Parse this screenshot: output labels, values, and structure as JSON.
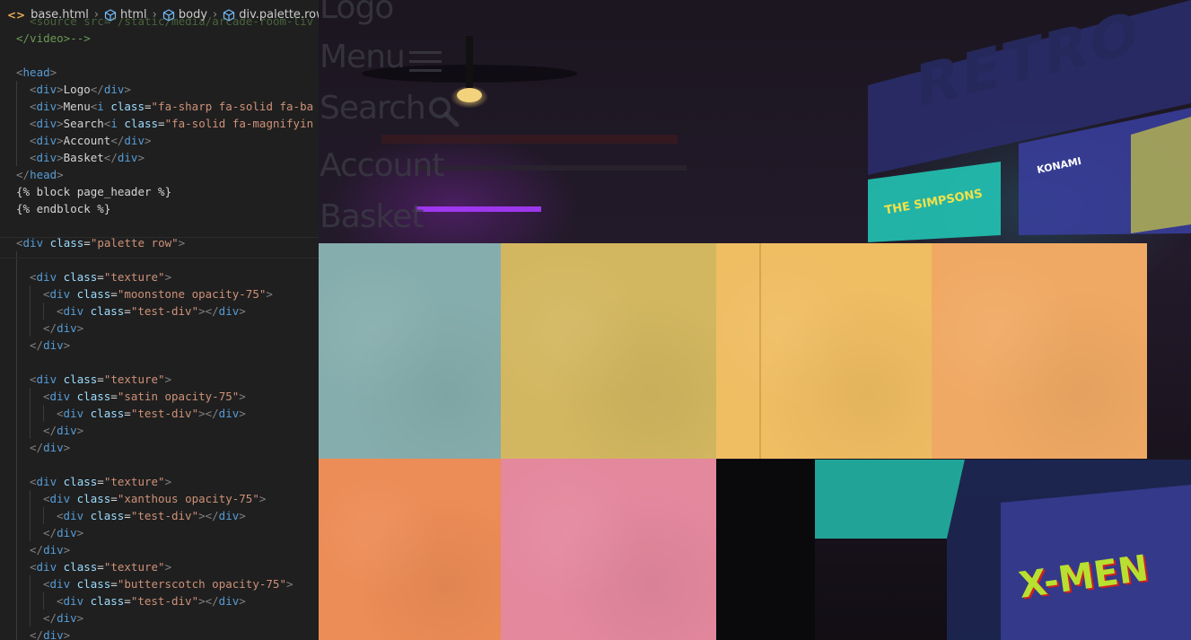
{
  "breadcrumb": {
    "items": [
      "base.html",
      "html",
      "body",
      "div.palette.row"
    ]
  },
  "code_lines": [
    {
      "y": -1,
      "indent": 1,
      "html": "  <source src=\"/static/media/arcade-room-liv"
    },
    {
      "y": 0,
      "indent": 0,
      "html": "</video>-->"
    },
    {
      "y": 1,
      "indent": 0,
      "html": ""
    },
    {
      "y": 2,
      "indent": 0,
      "html": "<head>"
    },
    {
      "y": 3,
      "indent": 1,
      "html": "<div>Logo</div>"
    },
    {
      "y": 4,
      "indent": 1,
      "html": "<div>Menu<i class=\"fa-sharp fa-solid fa-ba"
    },
    {
      "y": 5,
      "indent": 1,
      "html": "<div>Search<i class=\"fa-solid fa-magnifyin"
    },
    {
      "y": 6,
      "indent": 1,
      "html": "<div>Account</div>"
    },
    {
      "y": 7,
      "indent": 1,
      "html": "<div>Basket</div>"
    },
    {
      "y": 8,
      "indent": 0,
      "html": "</head>"
    },
    {
      "y": 9,
      "indent": 0,
      "html": "{% block page_header %}"
    },
    {
      "y": 10,
      "indent": 0,
      "html": "{% endblock %}"
    }
  ],
  "code": {
    "l0": "</video>-->",
    "l_src": "  <source src=\"/static/media/arcade-room-liv",
    "head_open": "<head>",
    "logo": "Logo",
    "menu": "Menu",
    "menu_class": "fa-sharp fa-solid fa-ba",
    "search": "Search",
    "search_class": "fa-solid fa-magnifyin",
    "account": "Account",
    "basket": "Basket",
    "head_close": "</head>",
    "block": "{% block page_header %}",
    "endblock": "{% endblock %}",
    "palette_class": "palette row",
    "texture": "texture",
    "moonstone": "moonstone opacity-75",
    "satin": "satin opacity-75",
    "xanthous": "xanthous opacity-75",
    "butterscotch": "butterscotch opacity-75",
    "test_div": "test-div"
  },
  "nav": {
    "logo": "Logo",
    "menu": "Menu",
    "search": "Search",
    "account": "Account",
    "basket": "Basket"
  },
  "palette": [
    {
      "name": "moonstone",
      "color": "#86adad"
    },
    {
      "name": "satin",
      "color": "#d3b760"
    },
    {
      "name": "xanthous",
      "color": "#efbd62"
    },
    {
      "name": "butterscotch",
      "color": "#f0a964"
    },
    {
      "name": "orange",
      "color": "#ec8c56"
    },
    {
      "name": "pink",
      "color": "#e4889e"
    }
  ],
  "signage": {
    "retro": "RETRO",
    "simpsons": "THE SIMPSONS",
    "konami": "KONAMI",
    "xmen": "X-MEN"
  }
}
